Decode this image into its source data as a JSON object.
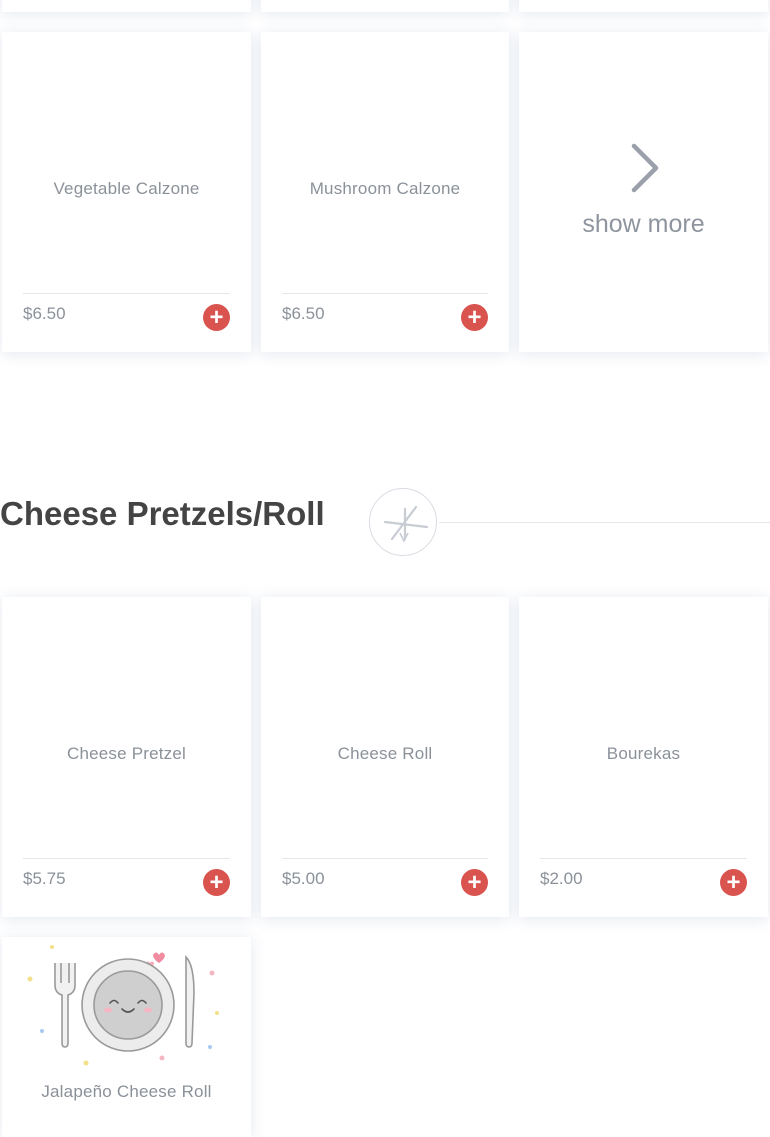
{
  "calzone_items": [
    {
      "name": "Vegetable Calzone",
      "price": "$6.50"
    },
    {
      "name": "Mushroom Calzone",
      "price": "$6.50"
    }
  ],
  "show_more": {
    "icon": "chevron-right-icon",
    "label": "show more"
  },
  "section": {
    "title": "Cheese Pretzels/Roll",
    "icon": "fork-knife-icon"
  },
  "pretzel_items": [
    {
      "name": "Cheese Pretzel",
      "price": "$5.75"
    },
    {
      "name": "Cheese Roll",
      "price": "$5.00"
    },
    {
      "name": "Bourekas",
      "price": "$2.00"
    },
    {
      "name": "Jalapeño Cheese Roll",
      "image": "plate-illustration"
    }
  ],
  "colors": {
    "accent": "#d9534f",
    "text": "#8b9199",
    "heading": "#444444"
  }
}
